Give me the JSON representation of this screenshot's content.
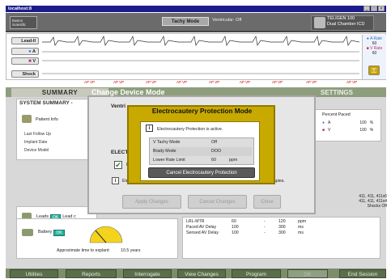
{
  "window": {
    "title": "localhost:8",
    "controls": [
      "_",
      "□",
      "×"
    ]
  },
  "header": {
    "logo": "Boston Scientific",
    "mode": "Tachy Mode",
    "ventricular": "Ventricular: Off",
    "device_line1": "TELIGEN 100",
    "device_line2": "Dual Chamber ICD"
  },
  "ecg": {
    "leads": [
      "Lead-II",
      "A",
      "V",
      "Shock"
    ],
    "rates": {
      "a_label": "A Rate",
      "a_value": "60",
      "v_label": "V Rate",
      "v_value": "60"
    },
    "markers": [
      "AP VP",
      "AP VP",
      "AP VP",
      "AP VP",
      "AP VP",
      "AP VP",
      "AP VP",
      "AP VP",
      "AP VP"
    ]
  },
  "tabs": {
    "summary": "SUMMARY",
    "settings": "SETTINGS",
    "dialog_title": "Change Device Mode"
  },
  "summary": {
    "title": "SYSTEM SUMMARY -",
    "patient_info": "Patient Info",
    "rows": [
      "Last Follow Up",
      "Implant Date",
      "Device Model"
    ],
    "leads_label": "Leads",
    "leads_ok": "OK",
    "lead_cont": "Lead c",
    "battery_label": "Battery",
    "battery_ok": "OK",
    "explant_label": "Approximate time to explant:",
    "explant_value": "10.5 years"
  },
  "percent_paced": {
    "title": "Percent Paced",
    "rows": [
      {
        "label": "A",
        "value": "100",
        "unit": "%"
      },
      {
        "label": "V",
        "value": "100",
        "unit": "%"
      }
    ]
  },
  "lead_values": [
    "411, 411, 411x6",
    "411, 411, 411x4",
    "Shocks Off"
  ],
  "params": [
    {
      "label": "LRL-MTR",
      "v1": "60",
      "dash": "-",
      "v2": "120",
      "unit": "ppm"
    },
    {
      "label": "Paced AV Delay",
      "v1": "100",
      "dash": "-",
      "v2": "300",
      "unit": "ms"
    },
    {
      "label": "Sensed AV Delay",
      "v1": "100",
      "dash": "-",
      "v2": "300",
      "unit": "ms"
    }
  ],
  "change_device_mode": {
    "ventricular": "Ventri",
    "electro_label": "ELECT",
    "check_label": "E",
    "info_label": "Ele",
    "therapies": "rapies.",
    "buttons": [
      "Apply Changes",
      "Cancel Changes",
      "Close"
    ]
  },
  "cautery_popup": {
    "title": "Electrocautery Protection Mode",
    "message": "Electrocautery Protection is active.",
    "rows": [
      {
        "label": "V Tachy Mode",
        "value": "Off",
        "unit": ""
      },
      {
        "label": "Brady Mode",
        "value": "DOO",
        "unit": ""
      },
      {
        "label": "Lower Rate Limit",
        "value": "60",
        "unit": "ppm"
      }
    ],
    "cancel_button": "Cancel Electrocautery Protection"
  },
  "bottom_bar": [
    "Utilities",
    "Reports",
    "Interrogate",
    "View Changes",
    "Program",
    "OK",
    "End Session"
  ]
}
